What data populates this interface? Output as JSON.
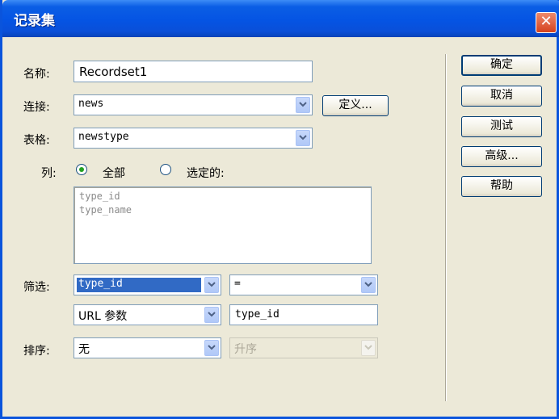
{
  "window": {
    "title": "记录集",
    "close_glyph": "✕"
  },
  "form": {
    "name_label": "名称:",
    "name_value": "Recordset1",
    "connection_label": "连接:",
    "connection_value": "news",
    "define_button": "定义...",
    "table_label": "表格:",
    "table_value": "newstype",
    "columns_label": "列:",
    "columns_all": "全部",
    "columns_selected": "选定的:",
    "columns_list": [
      "type_id",
      "type_name"
    ],
    "filter_label": "筛选:",
    "filter_column": "type_id",
    "filter_operator": "=",
    "filter_source": "URL 参数",
    "filter_value": "type_id",
    "sort_label": "排序:",
    "sort_column": "无",
    "sort_order": "升序"
  },
  "buttons": {
    "ok": "确定",
    "cancel": "取消",
    "test": "测试",
    "advanced": "高级...",
    "help": "帮助"
  },
  "icons": {
    "dropdown": "chevron-down-icon",
    "close": "close-icon"
  }
}
